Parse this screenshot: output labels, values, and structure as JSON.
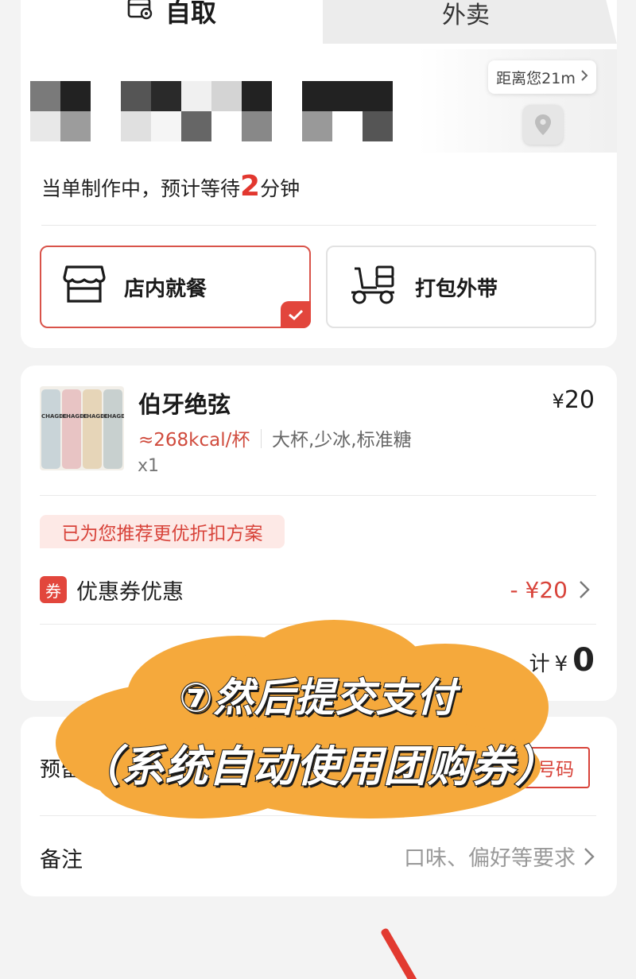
{
  "tabs": {
    "self_pickup": "自取",
    "delivery": "外卖"
  },
  "store": {
    "distance": "距离您21m"
  },
  "status": {
    "prefix": "当单制作中，预计等待",
    "minutes": "2",
    "suffix": "分钟"
  },
  "dine_modes": [
    {
      "label": "店内就餐",
      "icon": "store-icon",
      "selected": true
    },
    {
      "label": "打包外带",
      "icon": "scooter-icon",
      "selected": false
    }
  ],
  "order": {
    "item_name": "伯牙绝弦",
    "price": "20",
    "currency": "¥",
    "calories": "≈268kcal/杯",
    "spec": "大杯,少冰,标准糖",
    "quantity": "x1",
    "thumb_label": "CHAGEE"
  },
  "promo": {
    "recommend_text": "已为您推荐更优折扣方案",
    "coupon_badge": "券",
    "coupon_title": "优惠券优惠",
    "coupon_value": "- ¥20"
  },
  "total": {
    "label": "计",
    "currency": "¥",
    "value": "0"
  },
  "reserve": {
    "label": "预留",
    "button": "号码"
  },
  "note": {
    "label": "备注",
    "placeholder": "口味、偏好等要求"
  },
  "overlay": {
    "line1": "⑦然后提交支付",
    "line2": "（系统自动使用团购券）"
  },
  "colors": {
    "accent": "#e2463c",
    "sticker": "#f5a93c"
  }
}
